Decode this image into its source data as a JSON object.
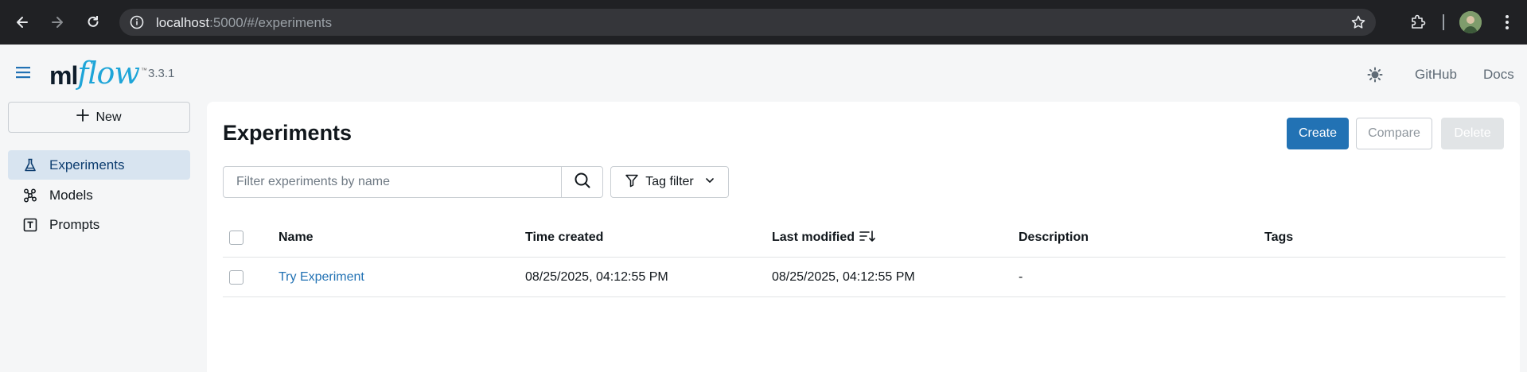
{
  "browser": {
    "url_host": "localhost",
    "url_rest": ":5000/#/experiments"
  },
  "app": {
    "logo_ml": "ml",
    "logo_flow": "flow",
    "logo_tm": "™",
    "version": "3.3.1",
    "header_links": [
      "GitHub",
      "Docs"
    ]
  },
  "sidebar": {
    "new_label": "New",
    "items": [
      {
        "label": "Experiments",
        "icon": "beaker-icon",
        "active": true
      },
      {
        "label": "Models",
        "icon": "models-icon",
        "active": false
      },
      {
        "label": "Prompts",
        "icon": "prompt-icon",
        "active": false
      }
    ]
  },
  "main": {
    "title": "Experiments",
    "buttons": {
      "create": "Create",
      "compare": "Compare",
      "delete": "Delete"
    },
    "search": {
      "placeholder": "Filter experiments by name"
    },
    "tag_filter_label": "Tag filter",
    "table": {
      "columns": [
        "Name",
        "Time created",
        "Last modified",
        "Description",
        "Tags"
      ],
      "rows": [
        {
          "name": "Try Experiment",
          "time_created": "08/25/2025, 04:12:55 PM",
          "last_modified": "08/25/2025, 04:12:55 PM",
          "description": "-",
          "tags": ""
        }
      ]
    }
  },
  "colors": {
    "accent": "#2272b4",
    "sidebar_active_bg": "#d8e4f0",
    "logo_flow": "#1ea5d8"
  }
}
